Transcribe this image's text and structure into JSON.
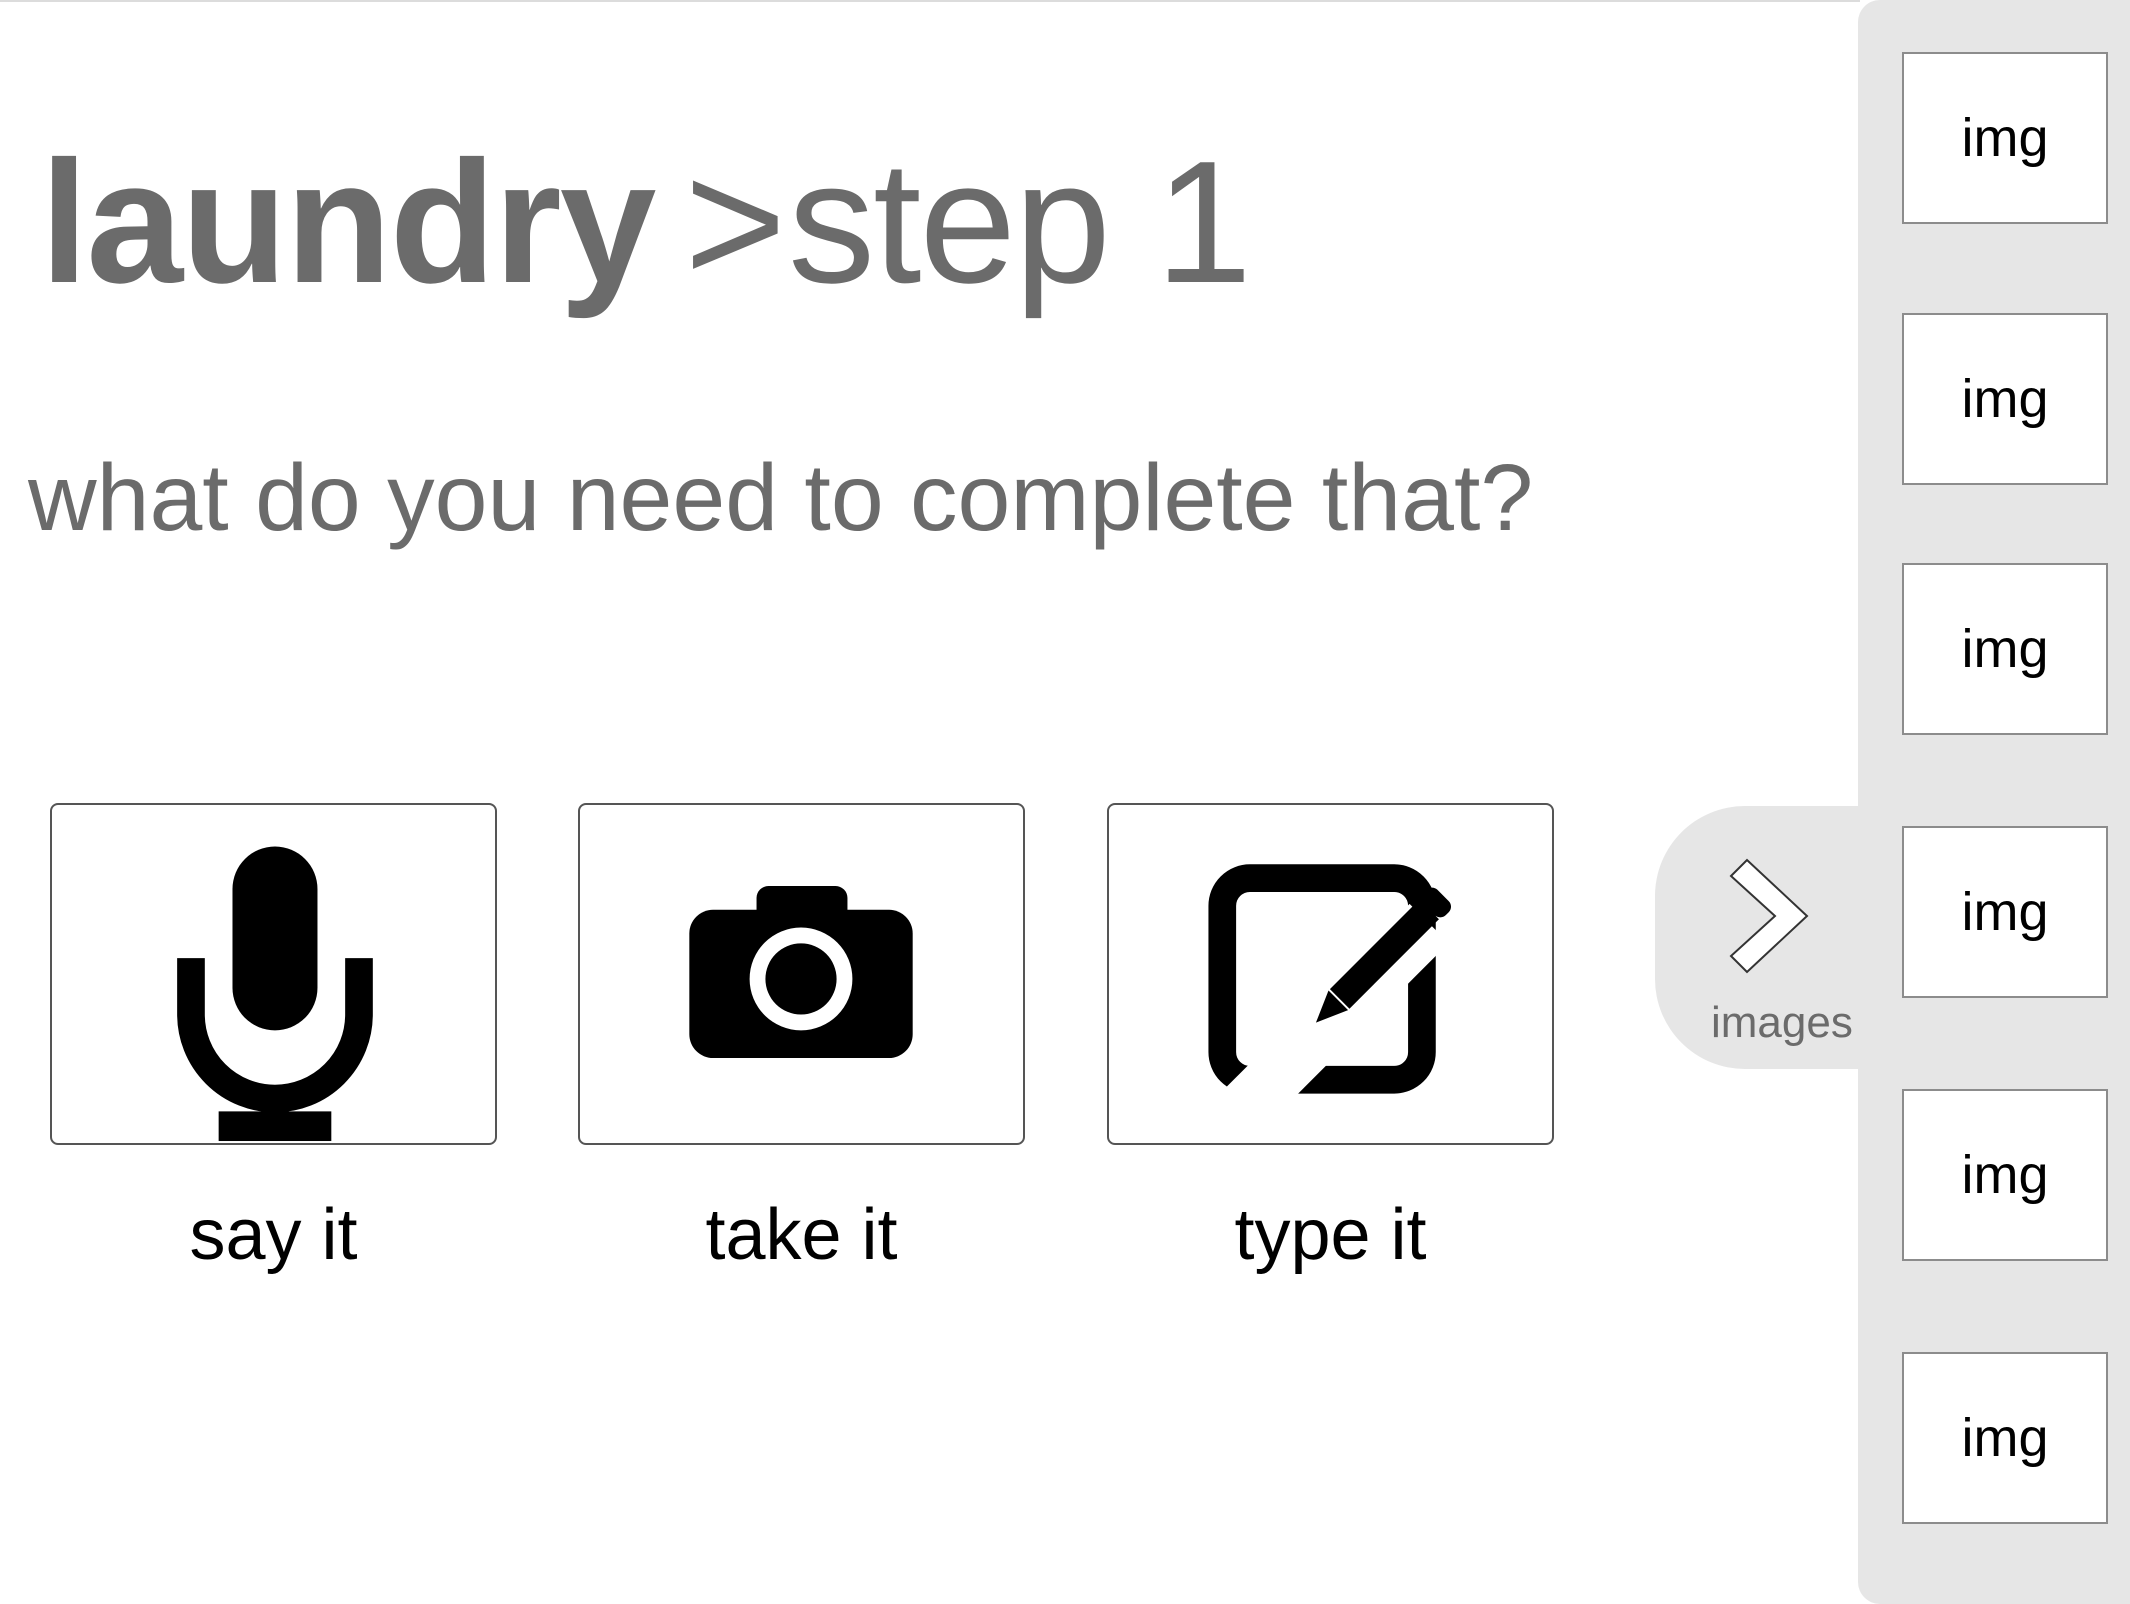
{
  "header": {
    "task": "laundry",
    "separator": ">",
    "step": "step 1"
  },
  "prompt": "what do you need to complete that?",
  "options": [
    {
      "label": "say it",
      "icon": "microphone-icon"
    },
    {
      "label": "take it",
      "icon": "camera-icon"
    },
    {
      "label": "type it",
      "icon": "edit-icon"
    }
  ],
  "drawer": {
    "label": "images",
    "icon": "chevron-right-icon"
  },
  "sidebar": {
    "thumbnails": [
      "img",
      "img",
      "img",
      "img",
      "img",
      "img"
    ]
  },
  "colors": {
    "heading_text": "#6b6b6b",
    "panel_background": "#e6e6e6",
    "icon": "#000000"
  }
}
